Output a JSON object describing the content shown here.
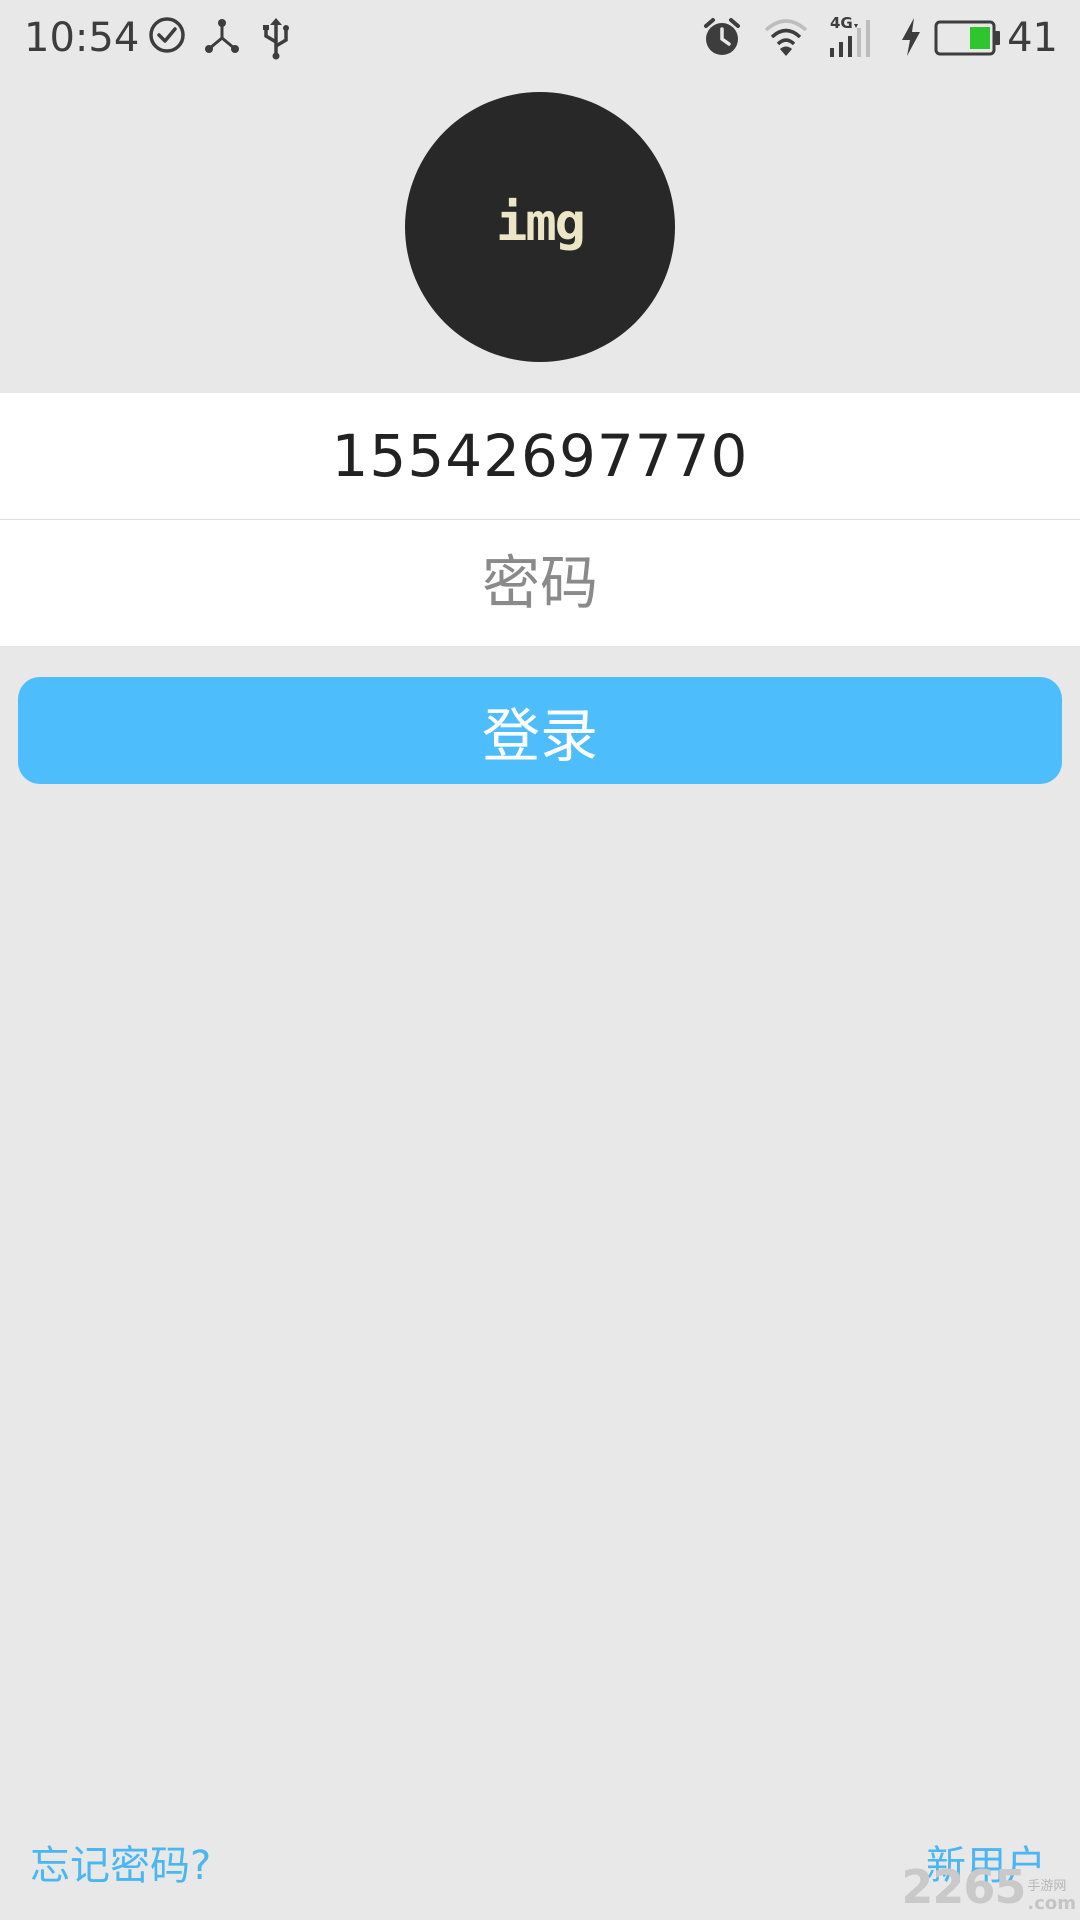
{
  "status_bar": {
    "time": "10:54",
    "battery_level": "41",
    "network_label": "4G",
    "battery_color": "#2ec52e",
    "icons": [
      "check-circle-icon",
      "share-node-icon",
      "usb-icon",
      "alarm-icon",
      "wifi-icon",
      "cellular-signal-icon",
      "charging-icon",
      "battery-icon"
    ]
  },
  "avatar": {
    "label": "img"
  },
  "form": {
    "phone_value": "15542697770",
    "password_placeholder": "密码",
    "login_label": "登录"
  },
  "links": {
    "forgot_password": "忘记密码?",
    "new_user": "新用户"
  },
  "watermark": {
    "brand": "2265",
    "site": "手游网",
    "domain": ".com"
  },
  "colors": {
    "accent": "#4dbdfb",
    "link": "#4ab6f2",
    "background": "#e8e8e9"
  }
}
